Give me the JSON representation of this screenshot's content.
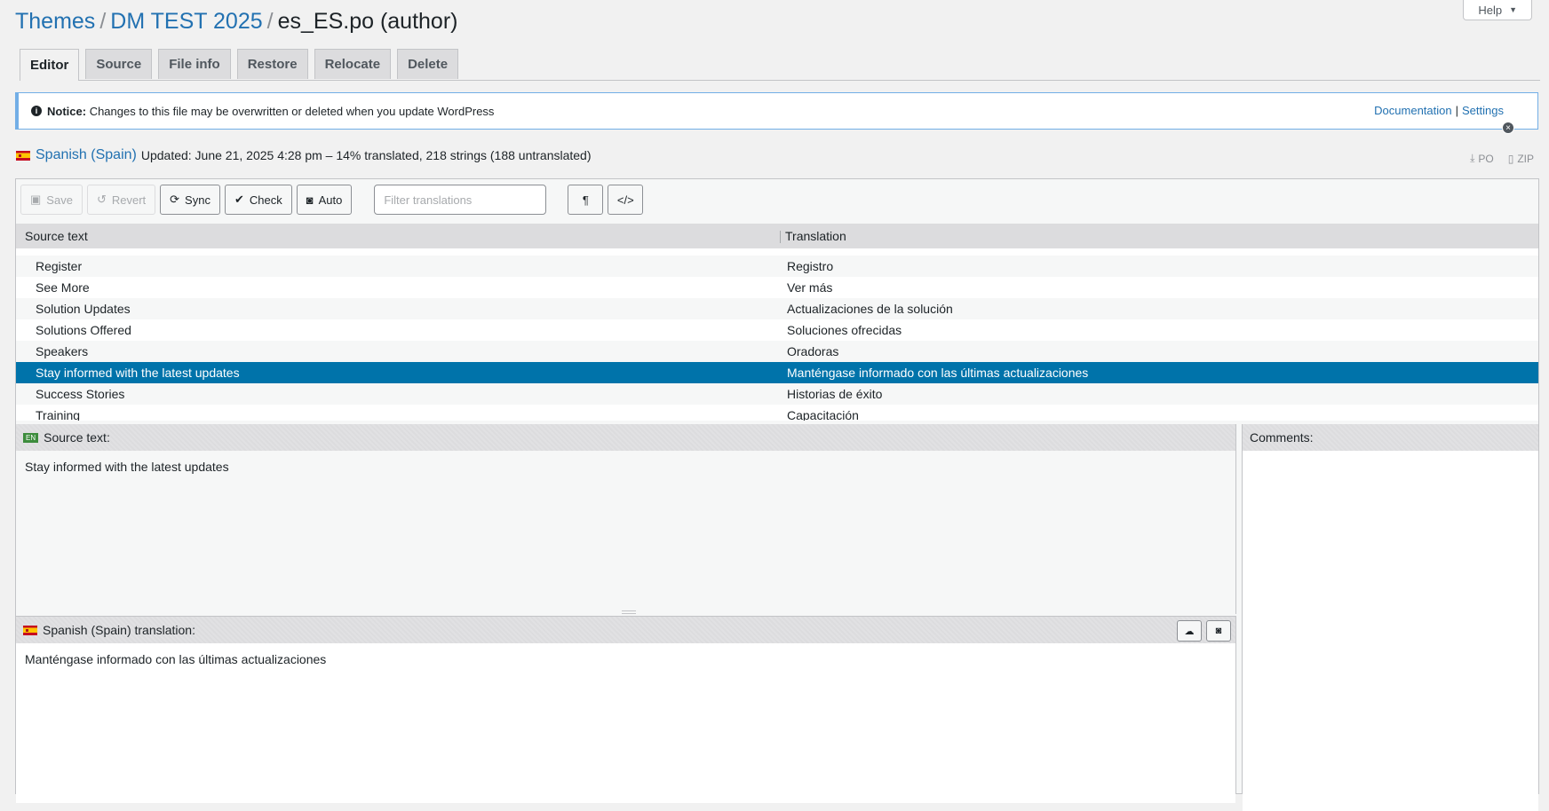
{
  "help": {
    "label": "Help"
  },
  "breadcrumb": {
    "themes": "Themes",
    "project": "DM TEST 2025",
    "file": "es_ES.po (author)"
  },
  "tabs": [
    "Editor",
    "Source",
    "File info",
    "Restore",
    "Relocate",
    "Delete"
  ],
  "notice": {
    "label": "Notice:",
    "text": "Changes to this file may be overwritten or deleted when you update WordPress",
    "documentation": "Documentation",
    "settings": "Settings"
  },
  "locale": {
    "name": "Spanish (Spain)",
    "status": "Updated: June 21, 2025 4:28 pm – 14% translated, 218 strings (188 untranslated)"
  },
  "downloads": {
    "po": "PO",
    "zip": "ZIP"
  },
  "toolbar": {
    "save": "Save",
    "revert": "Revert",
    "sync": "Sync",
    "check": "Check",
    "auto": "Auto",
    "filter_placeholder": "Filter translations"
  },
  "table": {
    "headers": {
      "source": "Source text",
      "translation": "Translation"
    },
    "rows": [
      {
        "source": "Register",
        "translation": "Registro"
      },
      {
        "source": "See More",
        "translation": "Ver más"
      },
      {
        "source": "Solution Updates",
        "translation": "Actualizaciones de la solución"
      },
      {
        "source": "Solutions Offered",
        "translation": "Soluciones ofrecidas"
      },
      {
        "source": "Speakers",
        "translation": "Oradoras"
      },
      {
        "source": "Stay informed with the latest updates",
        "translation": "Manténgase informado con las últimas actualizaciones"
      },
      {
        "source": "Success Stories",
        "translation": "Historias de éxito"
      },
      {
        "source": "Training",
        "translation": "Capacitación"
      }
    ]
  },
  "source_pane": {
    "badge": "EN",
    "title": "Source text:",
    "text": "Stay informed with the latest updates"
  },
  "translation_pane": {
    "title": "Spanish (Spain) translation:",
    "text": "Manténgase informado con las últimas actualizaciones"
  },
  "comments_pane": {
    "title": "Comments:"
  },
  "colors": {
    "accent": "#2271b1",
    "selected_row": "#0073aa"
  }
}
